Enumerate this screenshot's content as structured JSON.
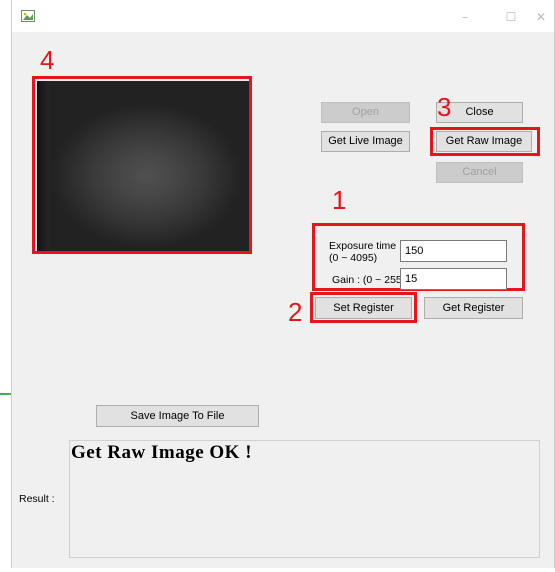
{
  "window": {
    "minimize_glyph": "–",
    "maximize_glyph": "☐",
    "close_glyph": "✕"
  },
  "buttons": {
    "open": "Open",
    "close": "Close",
    "get_live_image": "Get Live Image",
    "get_raw_image": "Get Raw Image",
    "cancel": "Cancel",
    "set_register": "Set Register",
    "get_register": "Get Register",
    "save_image": "Save Image To File"
  },
  "registers": {
    "exposure_label": "Exposure time :\n(0 ~ 4095)",
    "exposure_value": "150",
    "gain_label": "Gain : (0 ~ 255)",
    "gain_value": "15"
  },
  "result": {
    "label": "Result :",
    "message": "Get Raw Image OK !"
  },
  "annotations": {
    "n1": "1",
    "n2": "2",
    "n3": "3",
    "n4": "4"
  },
  "colors": {
    "annotation": "#e8141b",
    "window_bg": "#f0f0f0",
    "button_bg": "#e1e1e1"
  }
}
